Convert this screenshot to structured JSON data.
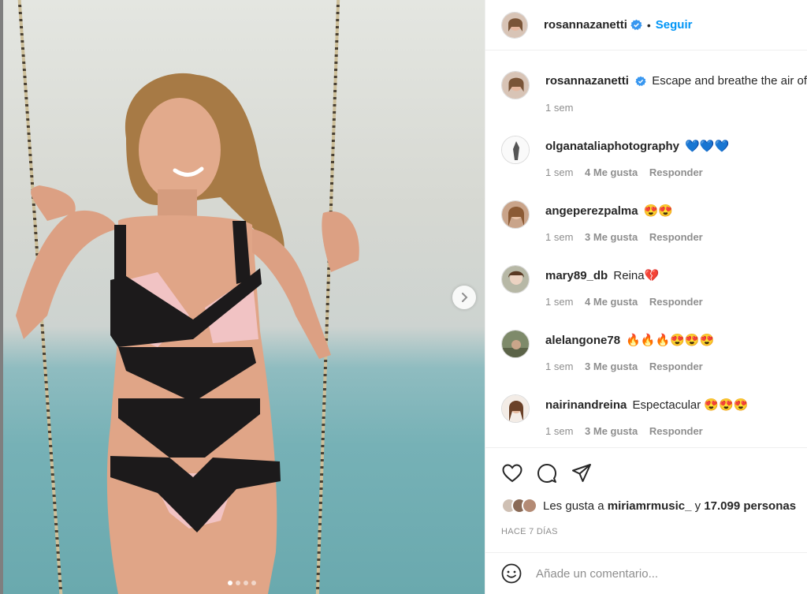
{
  "post": {
    "author": "rosannazanetti",
    "follow_label": "Seguir",
    "separator": "•",
    "caption": "Escape and breathe the air of",
    "caption_time": "1 sem"
  },
  "carousel": {
    "slides": 4,
    "current": 1
  },
  "comments": [
    {
      "user": "olganataliaphotography",
      "text": "💙💙💙",
      "time": "1 sem",
      "likes": "4 Me gusta",
      "reply": "Responder"
    },
    {
      "user": "angeperezpalma",
      "text": "😍😍",
      "time": "1 sem",
      "likes": "3 Me gusta",
      "reply": "Responder"
    },
    {
      "user": "mary89_db",
      "text": "Reina💔",
      "time": "1 sem",
      "likes": "4 Me gusta",
      "reply": "Responder"
    },
    {
      "user": "alelangone78",
      "text": "🔥🔥🔥😍😍😍",
      "time": "1 sem",
      "likes": "3 Me gusta",
      "reply": "Responder"
    },
    {
      "user": "nairinandreina",
      "text": "Espectacular 😍😍😍",
      "time": "1 sem",
      "likes": "3 Me gusta",
      "reply": "Responder"
    }
  ],
  "likes_summary": {
    "prefix": "Les gusta a",
    "user": "miriamrmusic_",
    "connector": "y",
    "others": "17.099 personas"
  },
  "posted_ago": "HACE 7 DÍAS",
  "add_comment": {
    "placeholder": "Añade un comentario..."
  },
  "icons": {
    "like": "heart-icon",
    "comment": "comment-icon",
    "share": "share-icon",
    "emoji": "emoji-icon",
    "verified": "verified-badge-icon",
    "next": "chevron-right-icon"
  },
  "colors": {
    "accent": "#0095f6",
    "text": "#262626",
    "muted": "#8e8e8e",
    "border": "#efefef"
  }
}
